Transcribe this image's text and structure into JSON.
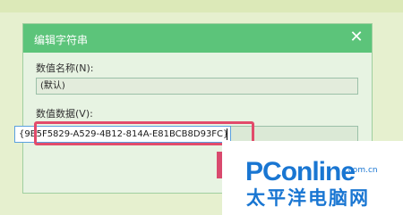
{
  "dialog": {
    "title": "编辑字符串",
    "close_glyph": "✕",
    "value_name_label": "数值名称(N):",
    "value_name": "(默认)",
    "value_data_label": "数值数据(V):",
    "value_data": "{9B5F5829-A529-4B12-814A-E81BCB8D93FC}"
  },
  "watermark": {
    "brand_a": "PC",
    "brand_b": "online",
    "suffix": ".com.cn",
    "chinese": "太平洋电脑网"
  },
  "colors": {
    "titlebar": "#5cc47a",
    "highlight": "#e24b6b",
    "brand": "#1976d2"
  }
}
